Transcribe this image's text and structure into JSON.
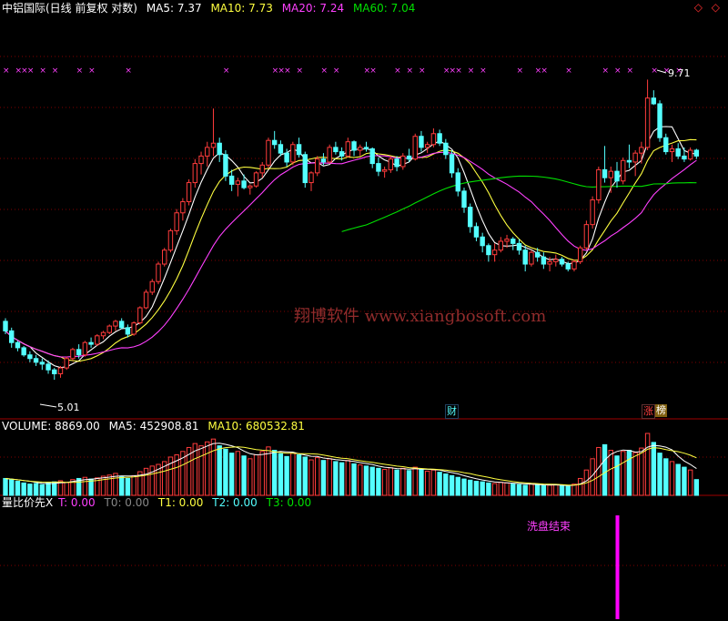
{
  "header": {
    "title": "中铝国际(日线 前复权 对数)",
    "ma5": "MA5: 7.37",
    "ma10": "MA10: 7.73",
    "ma20": "MA20: 7.24",
    "ma60": "MA60: 7.04"
  },
  "corner_icons": "◇ ◇",
  "watermark": "翔博软件 www.xiangbosoft.com",
  "annotations": {
    "high_label": "9.71",
    "low_label": "5.01"
  },
  "badges": {
    "cai": "财",
    "zhang": "涨",
    "bang": "榜"
  },
  "volume_header": {
    "volume": "VOLUME: 8869.00",
    "ma5": "MA5: 452908.81",
    "ma10": "MA10: 680532.81"
  },
  "indicator_header": {
    "name": "量比价先X",
    "t": "T: 0.00",
    "t0": "T0: 0.00",
    "t1": "T1: 0.00",
    "t2": "T2: 0.00",
    "t3": "T3: 0.00"
  },
  "indicator_label": "洗盘结束",
  "colors": {
    "up": "#ff3c3c",
    "down": "#54ffff",
    "ma5": "#ffffff",
    "ma10": "#ffff40",
    "ma20": "#ff40ff",
    "ma60": "#00e000",
    "marker": "#ff40ff",
    "signal": "#ff00ff",
    "grid": "#800000"
  },
  "chart_data": {
    "type": "candlestick",
    "price": [
      [
        7.1,
        7.2,
        6.7,
        6.8
      ],
      [
        6.8,
        6.9,
        6.3,
        6.45
      ],
      [
        6.45,
        6.5,
        6.2,
        6.3
      ],
      [
        6.3,
        6.35,
        6.05,
        6.1
      ],
      [
        6.1,
        6.2,
        5.9,
        6.0
      ],
      [
        6.0,
        6.1,
        5.8,
        5.9
      ],
      [
        5.9,
        6.0,
        5.7,
        5.85
      ],
      [
        5.85,
        5.95,
        5.6,
        5.7
      ],
      [
        5.7,
        5.75,
        5.45,
        5.6
      ],
      [
        5.6,
        5.8,
        5.5,
        5.75
      ],
      [
        5.75,
        6.05,
        5.7,
        6.0
      ],
      [
        6.0,
        6.3,
        5.95,
        6.25
      ],
      [
        6.25,
        6.4,
        6.0,
        6.1
      ],
      [
        6.1,
        6.5,
        6.05,
        6.45
      ],
      [
        6.45,
        6.6,
        6.3,
        6.4
      ],
      [
        6.4,
        6.7,
        6.35,
        6.65
      ],
      [
        6.65,
        6.8,
        6.55,
        6.75
      ],
      [
        6.75,
        7.0,
        6.7,
        6.95
      ],
      [
        6.95,
        7.15,
        6.8,
        7.1
      ],
      [
        7.1,
        7.2,
        6.85,
        6.9
      ],
      [
        6.9,
        7.0,
        6.6,
        6.7
      ],
      [
        6.7,
        7.1,
        6.65,
        7.05
      ],
      [
        7.05,
        7.6,
        7.0,
        7.55
      ],
      [
        7.55,
        8.2,
        7.5,
        8.1
      ],
      [
        8.1,
        8.6,
        8.0,
        8.5
      ],
      [
        8.5,
        9.3,
        8.4,
        9.2
      ],
      [
        9.2,
        9.9,
        9.1,
        9.8
      ],
      [
        9.8,
        10.8,
        9.7,
        10.7
      ],
      [
        10.7,
        11.8,
        10.5,
        11.6
      ],
      [
        11.6,
        12.4,
        11.2,
        12.2
      ],
      [
        12.2,
        13.5,
        12.0,
        13.3
      ],
      [
        13.3,
        14.8,
        13.0,
        14.5
      ],
      [
        14.5,
        15.3,
        13.8,
        15.0
      ],
      [
        15.0,
        16.0,
        14.3,
        15.6
      ],
      [
        15.6,
        18.6,
        15.0,
        15.9
      ],
      [
        15.9,
        16.3,
        14.6,
        15.1
      ],
      [
        15.1,
        15.4,
        13.4,
        13.7
      ],
      [
        13.7,
        14.1,
        12.8,
        13.2
      ],
      [
        13.2,
        13.6,
        12.5,
        13.4
      ],
      [
        13.4,
        13.8,
        12.9,
        13.0
      ],
      [
        13.0,
        13.2,
        12.6,
        13.1
      ],
      [
        13.1,
        14.0,
        13.0,
        13.9
      ],
      [
        13.9,
        14.6,
        13.6,
        14.4
      ],
      [
        14.4,
        16.3,
        14.2,
        16.1
      ],
      [
        16.1,
        16.8,
        15.5,
        15.8
      ],
      [
        15.8,
        16.1,
        15.0,
        15.2
      ],
      [
        15.2,
        15.5,
        14.3,
        14.6
      ],
      [
        14.6,
        16.0,
        14.4,
        15.8
      ],
      [
        15.8,
        16.3,
        14.9,
        15.1
      ],
      [
        15.1,
        15.3,
        13.0,
        13.3
      ],
      [
        13.3,
        14.0,
        12.8,
        13.9
      ],
      [
        13.9,
        15.0,
        13.7,
        14.8
      ],
      [
        14.8,
        15.2,
        14.4,
        14.6
      ],
      [
        14.6,
        15.8,
        14.5,
        15.6
      ],
      [
        15.6,
        16.0,
        15.1,
        15.3
      ],
      [
        15.3,
        15.6,
        14.7,
        15.0
      ],
      [
        15.0,
        16.3,
        14.9,
        16.0
      ],
      [
        16.0,
        16.1,
        15.0,
        15.4
      ],
      [
        15.4,
        15.8,
        15.0,
        15.6
      ],
      [
        15.6,
        16.0,
        15.3,
        15.5
      ],
      [
        15.5,
        15.6,
        14.2,
        14.5
      ],
      [
        14.5,
        14.9,
        13.7,
        14.0
      ],
      [
        14.0,
        14.3,
        13.6,
        14.1
      ],
      [
        14.1,
        15.0,
        13.9,
        14.8
      ],
      [
        14.8,
        15.0,
        14.0,
        14.3
      ],
      [
        14.3,
        15.2,
        14.1,
        15.0
      ],
      [
        15.0,
        15.5,
        14.6,
        14.8
      ],
      [
        14.8,
        16.6,
        14.7,
        16.4
      ],
      [
        16.4,
        16.8,
        15.3,
        15.6
      ],
      [
        15.6,
        16.0,
        15.2,
        15.8
      ],
      [
        15.8,
        17.0,
        15.6,
        16.6
      ],
      [
        16.6,
        16.9,
        15.7,
        15.9
      ],
      [
        15.9,
        16.2,
        14.8,
        15.1
      ],
      [
        15.1,
        15.4,
        13.6,
        13.9
      ],
      [
        13.9,
        14.2,
        12.5,
        12.8
      ],
      [
        12.8,
        13.0,
        11.6,
        11.9
      ],
      [
        11.9,
        12.1,
        10.6,
        10.9
      ],
      [
        10.9,
        11.1,
        10.2,
        10.4
      ],
      [
        10.4,
        10.6,
        9.7,
        10.0
      ],
      [
        10.0,
        10.1,
        9.3,
        9.6
      ],
      [
        9.6,
        10.1,
        9.3,
        9.8
      ],
      [
        9.8,
        10.4,
        9.7,
        10.2
      ],
      [
        10.2,
        10.5,
        9.9,
        10.3
      ],
      [
        10.3,
        10.4,
        9.8,
        10.1
      ],
      [
        10.1,
        10.3,
        9.6,
        9.8
      ],
      [
        9.8,
        10.0,
        8.9,
        9.2
      ],
      [
        9.2,
        9.8,
        9.1,
        9.7
      ],
      [
        9.7,
        9.9,
        9.3,
        9.5
      ],
      [
        9.5,
        9.7,
        9.0,
        9.2
      ],
      [
        9.2,
        9.5,
        8.9,
        9.3
      ],
      [
        9.3,
        9.6,
        9.1,
        9.4
      ],
      [
        9.4,
        9.5,
        9.1,
        9.2
      ],
      [
        9.2,
        9.3,
        8.9,
        9.0
      ],
      [
        9.0,
        9.4,
        8.9,
        9.3
      ],
      [
        9.3,
        10.0,
        9.2,
        9.9
      ],
      [
        9.9,
        11.2,
        9.8,
        11.0
      ],
      [
        11.0,
        12.5,
        10.8,
        12.3
      ],
      [
        12.3,
        14.3,
        12.1,
        14.1
      ],
      [
        14.1,
        15.7,
        13.3,
        13.6
      ],
      [
        13.6,
        14.3,
        12.7,
        14.0
      ],
      [
        14.0,
        14.6,
        13.0,
        13.4
      ],
      [
        13.4,
        14.9,
        13.2,
        14.7
      ],
      [
        14.7,
        15.8,
        14.2,
        14.6
      ],
      [
        14.6,
        15.4,
        13.7,
        15.2
      ],
      [
        15.2,
        16.0,
        14.5,
        15.6
      ],
      [
        15.6,
        21.2,
        15.4,
        19.5
      ],
      [
        19.5,
        20.2,
        18.9,
        19.0
      ],
      [
        19.0,
        19.3,
        16.0,
        16.3
      ],
      [
        16.3,
        16.6,
        15.1,
        15.3
      ],
      [
        15.3,
        15.8,
        14.6,
        15.5
      ],
      [
        15.5,
        15.9,
        14.8,
        15.0
      ],
      [
        15.0,
        15.6,
        14.6,
        14.8
      ],
      [
        14.8,
        15.6,
        14.7,
        15.4
      ],
      [
        15.4,
        15.5,
        14.8,
        15.0
      ]
    ],
    "volume": [
      3.0,
      2.8,
      2.5,
      2.2,
      2.0,
      2.1,
      1.9,
      2.2,
      2.4,
      2.6,
      2.3,
      2.8,
      3.0,
      3.2,
      2.9,
      3.1,
      3.4,
      3.6,
      3.9,
      3.3,
      3.0,
      3.5,
      4.2,
      4.8,
      5.2,
      5.5,
      6.0,
      6.8,
      7.2,
      7.8,
      8.5,
      9.2,
      8.8,
      9.5,
      10.0,
      8.8,
      8.2,
      7.5,
      7.8,
      7.0,
      6.5,
      7.2,
      7.8,
      8.6,
      8.0,
      7.4,
      6.9,
      7.5,
      7.2,
      6.8,
      6.3,
      6.7,
      6.2,
      6.5,
      6.0,
      5.8,
      6.2,
      5.6,
      5.4,
      5.2,
      5.0,
      4.8,
      4.6,
      4.9,
      4.5,
      4.8,
      4.4,
      5.0,
      4.6,
      4.3,
      4.5,
      4.1,
      3.8,
      3.5,
      3.2,
      2.9,
      2.7,
      2.5,
      2.4,
      2.2,
      2.1,
      2.3,
      2.2,
      2.0,
      1.9,
      1.8,
      2.0,
      1.9,
      1.7,
      1.8,
      1.9,
      1.7,
      1.6,
      2.0,
      3.0,
      4.5,
      6.5,
      8.5,
      9.0,
      8.0,
      7.0,
      7.8,
      8.0,
      7.6,
      8.4,
      11.0,
      9.4,
      7.5,
      6.5,
      6.0,
      5.5,
      5.0,
      4.5,
      2.8
    ],
    "ma60_start": 55,
    "signal_index": 100,
    "y_axis": {
      "scale": "log",
      "range": [
        5.0,
        21.5
      ]
    },
    "ma_colors": [
      "#ffffff",
      "#ffff40",
      "#ff40ff",
      "#00e000"
    ],
    "grid": true
  }
}
